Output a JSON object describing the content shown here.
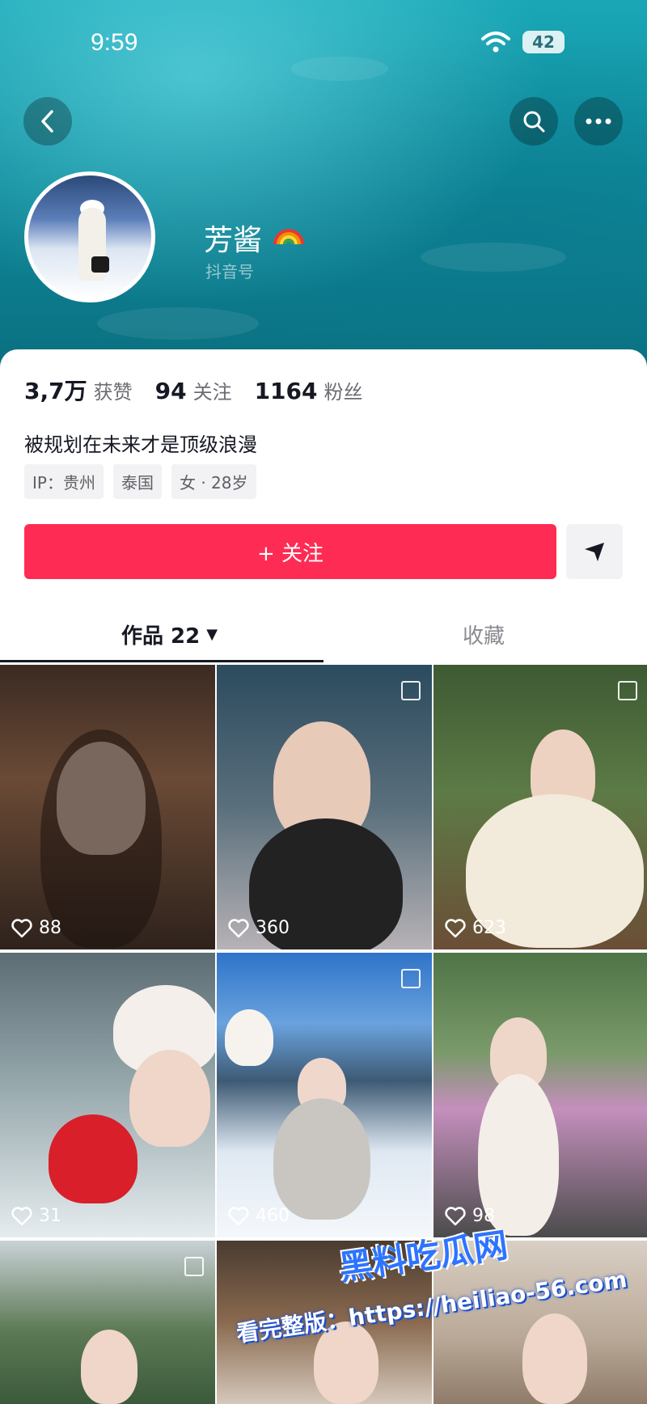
{
  "status_bar": {
    "time": "9:59",
    "battery": "42"
  },
  "header": {
    "profile_name": "芳酱",
    "id_label": "抖音号"
  },
  "stats": [
    {
      "value": "3,7万",
      "label": "获赞"
    },
    {
      "value": "94",
      "label": "关注"
    },
    {
      "value": "1164",
      "label": "粉丝"
    }
  ],
  "bio": "被规划在未来才是顶级浪漫",
  "tags": [
    "IP：贵州",
    "泰国",
    "女 · 28岁"
  ],
  "actions": {
    "follow_label": "+ 关注"
  },
  "tabs": {
    "works_label": "作品 22",
    "favorites_label": "收藏"
  },
  "posts": [
    {
      "likes": "88"
    },
    {
      "likes": "360"
    },
    {
      "likes": "623"
    },
    {
      "likes": "31"
    },
    {
      "likes": "460"
    },
    {
      "likes": "98"
    },
    {
      "likes": ""
    },
    {
      "likes": ""
    },
    {
      "likes": ""
    }
  ],
  "watermark": {
    "title": "黑料吃瓜网",
    "url": "看完整版：https://heiliao-56.com"
  },
  "colors": {
    "follow": "#fe2c55",
    "text": "#161823",
    "muted": "#8a8a90"
  },
  "icons": [
    "back-icon",
    "search-icon",
    "more-icon",
    "rainbow-icon",
    "share-icon",
    "heart-icon",
    "pin-icon",
    "wifi-icon"
  ]
}
